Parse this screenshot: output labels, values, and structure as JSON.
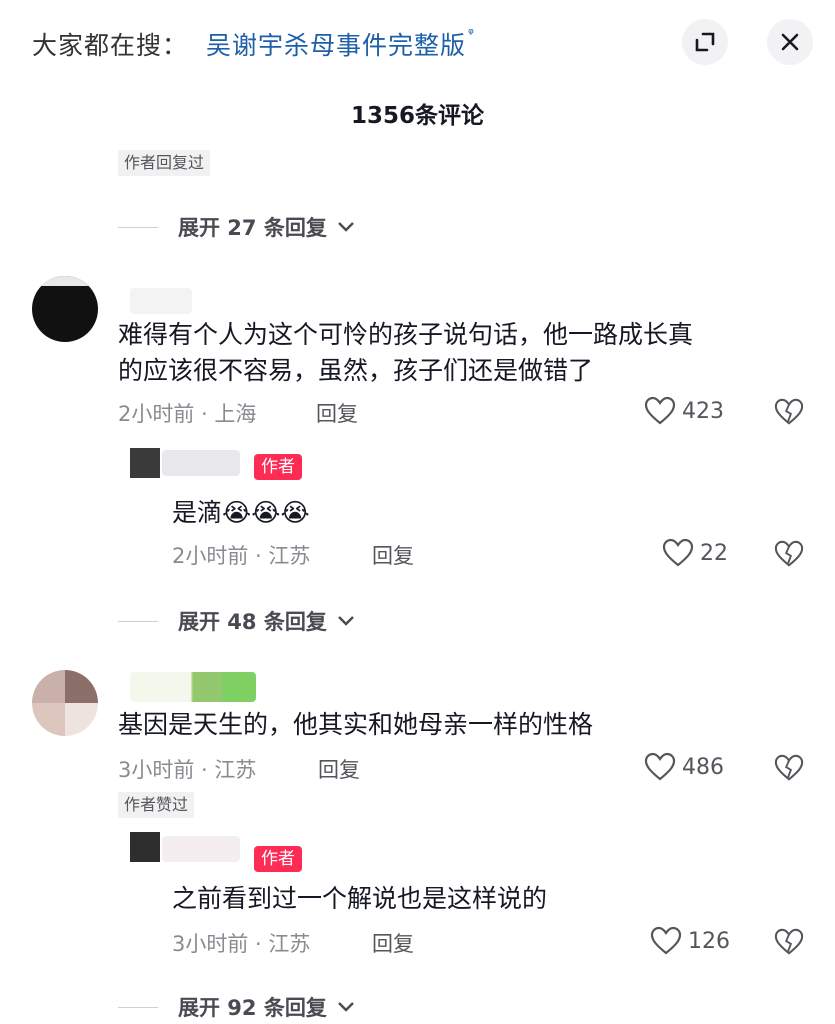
{
  "header": {
    "search_prefix": "大家都在搜：",
    "search_term": "吴谢宇杀母事件完整版",
    "search_mark": "ᵠ",
    "comment_count": "1356条评论"
  },
  "top": {
    "author_replied_tag": "作者回复过",
    "expand_label": "展开 27 条回复"
  },
  "comments": [
    {
      "text_line1": "难得有个人为这个可怜的孩子说句话，他一路成长真",
      "text_line2": "的应该很不容易，虽然，孩子们还是做错了",
      "meta": "2小时前 · 上海",
      "reply_label": "回复",
      "likes": "423",
      "sub_reply": {
        "author_tag": "作者",
        "text": "是滴",
        "emojis": "😭😭😭",
        "meta": "2小时前 · 江苏",
        "reply_label": "回复",
        "likes": "22"
      },
      "expand_label": "展开 48 条回复"
    },
    {
      "text_line1": "基因是天生的，他其实和她母亲一样的性格",
      "meta": "3小时前 · 江苏",
      "reply_label": "回复",
      "likes": "486",
      "author_liked_tag": "作者赞过",
      "sub_reply": {
        "author_tag": "作者",
        "text": "之前看到过一个解说也是这样说的",
        "meta": "3小时前 · 江苏",
        "reply_label": "回复",
        "likes": "126"
      },
      "expand_label": "展开 92 条回复"
    }
  ],
  "colors": {
    "link": "#1d5fa8",
    "author_tag": "#fe2c55",
    "meta": "#8a8b91"
  },
  "icons": [
    "search-mark-icon",
    "expand-icon",
    "close-icon",
    "heart-icon",
    "broken-heart-icon",
    "chevron-down-icon"
  ]
}
